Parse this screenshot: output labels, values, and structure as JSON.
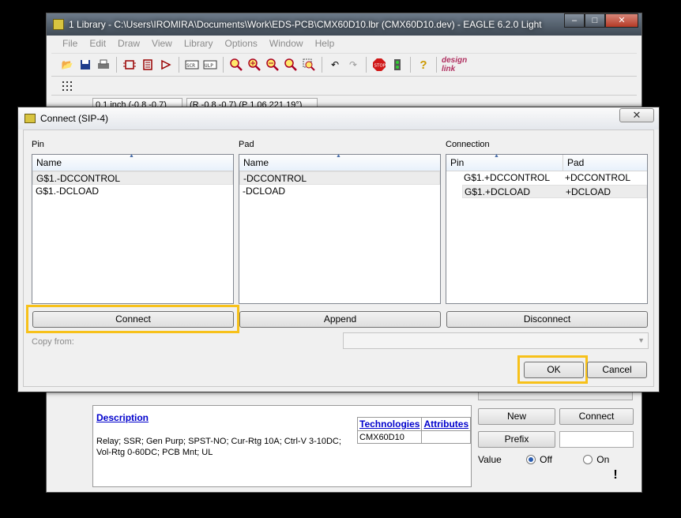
{
  "main_window": {
    "title": "1 Library - C:\\Users\\IROMIRA\\Documents\\Work\\EDS-PCB\\CMX60D10.lbr (CMX60D10.dev) - EAGLE 6.2.0 Light",
    "controls": {
      "minimize": "–",
      "maximize": "□",
      "close": "✕"
    },
    "menu": [
      "File",
      "Edit",
      "Draw",
      "View",
      "Library",
      "Options",
      "Window",
      "Help"
    ],
    "toolbar_icons": [
      "open-icon",
      "save-icon",
      "print-icon",
      "schematic-icon",
      "board-icon",
      "symbol-icon",
      "package-icon",
      "device-icon",
      "script-icon",
      "ulp-icon",
      "zoom-fit-icon",
      "zoom-in-icon",
      "zoom-out-icon",
      "zoom-redraw-icon",
      "zoom-select-icon",
      "undo-icon",
      "redo-icon",
      "stop-icon",
      "go-icon",
      "help-icon",
      "design-link-icon"
    ],
    "toolbar_brand": "design link",
    "stop_label": "STOP",
    "grid_status": "0.1 inch (-0.8 -0.7)",
    "coord_status": "(R -0.8 -0.7) (P 1.06 221.19°)",
    "description": {
      "heading": "Description",
      "text": "Relay; SSR; Gen Purp; SPST-NO; Cur-Rtg 10A; Ctrl-V 3-10DC; Vol-Rtg 0-60DC; PCB Mnt; UL"
    },
    "tech_table": {
      "headers": [
        "Technologies",
        "Attributes"
      ],
      "rows": [
        [
          "CMX60D10",
          ""
        ]
      ]
    },
    "side_buttons": {
      "new": "New",
      "connect": "Connect",
      "prefix": "Prefix"
    },
    "value_label": "Value",
    "value_options": {
      "off": "Off",
      "on": "On",
      "selected": "Off"
    },
    "warning_mark": "!"
  },
  "dialog": {
    "title": "Connect  (SIP-4)",
    "close": "✕",
    "pin": {
      "label": "Pin",
      "column": "Name",
      "items": [
        "G$1.-DCCONTROL",
        "G$1.-DCLOAD"
      ]
    },
    "pad": {
      "label": "Pad",
      "column": "Name",
      "items": [
        "-DCCONTROL",
        "-DCLOAD"
      ]
    },
    "connection": {
      "label": "Connection",
      "columns": [
        "Pin",
        "Pad"
      ],
      "rows": [
        {
          "pin": "G$1.+DCCONTROL",
          "pad": "+DCCONTROL"
        },
        {
          "pin": "G$1.+DCLOAD",
          "pad": "+DCLOAD"
        }
      ]
    },
    "buttons": {
      "connect": "Connect",
      "append": "Append",
      "disconnect": "Disconnect",
      "ok": "OK",
      "cancel": "Cancel"
    },
    "copy_from": {
      "label": "Copy from:",
      "value": ""
    },
    "highlight_color": "#f7c11a"
  }
}
